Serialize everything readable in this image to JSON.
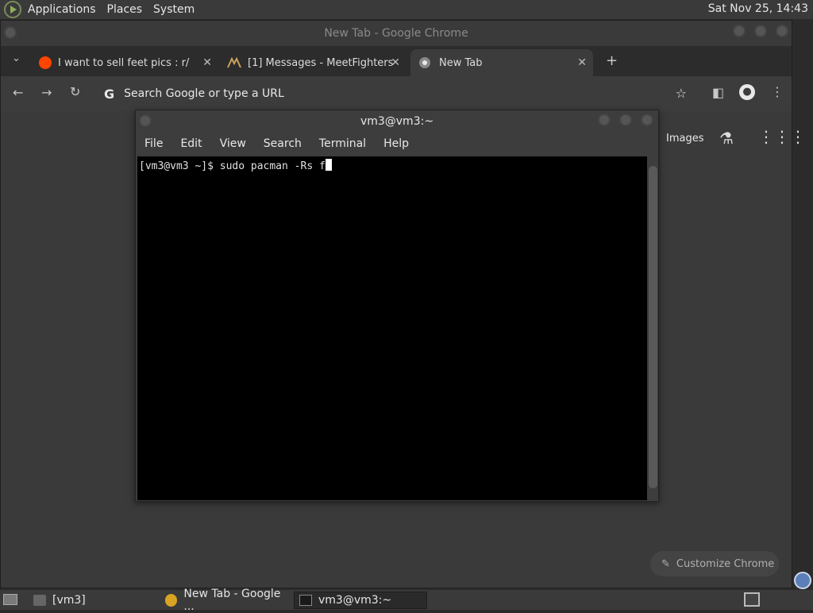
{
  "top_panel": {
    "menus": [
      "Applications",
      "Places",
      "System"
    ],
    "clock": "Sat Nov 25, 14:43"
  },
  "chrome": {
    "title": "New Tab - Google Chrome",
    "tabs": [
      {
        "label": "I want to sell feet pics : r/side",
        "icon": "reddit-icon"
      },
      {
        "label": "[1] Messages - MeetFighters",
        "icon": "meetfighters-icon"
      },
      {
        "label": "New Tab",
        "icon": "chrome-icon"
      }
    ],
    "omnibox_placeholder": "Search Google or type a URL",
    "ntp": {
      "images_link": "Images",
      "customize_label": "Customize Chrome"
    }
  },
  "terminal": {
    "title": "vm3@vm3:~",
    "menu": [
      "File",
      "Edit",
      "View",
      "Search",
      "Terminal",
      "Help"
    ],
    "prompt": "[vm3@vm3 ~]$ sudo pacman -Rs f"
  },
  "bottom_panel": {
    "tasks": [
      "[vm3]",
      "New Tab - Google ...",
      "vm3@vm3:~"
    ]
  },
  "colors": {
    "panel": "#3a3a3a",
    "terminal_bg": "#000000",
    "reddit": "#ff4500"
  }
}
